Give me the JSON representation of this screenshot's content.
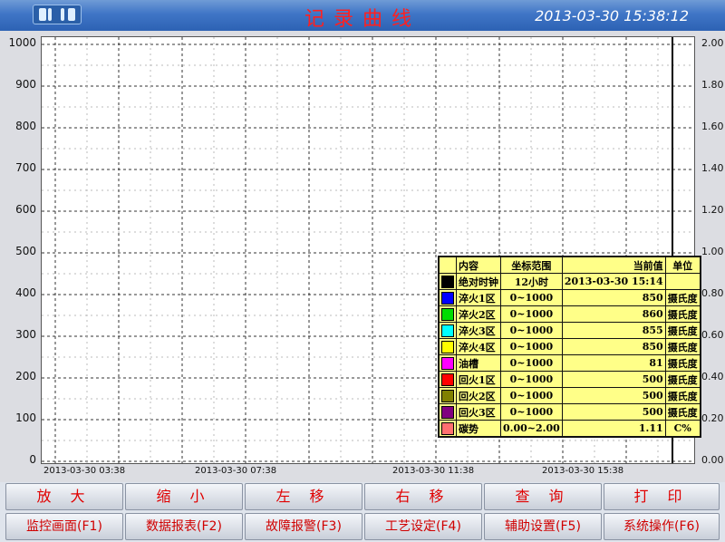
{
  "app": {
    "title": "记录曲线",
    "datetime": "2013-03-30 15:38:12",
    "logo": "HD-logo"
  },
  "chart_data": {
    "type": "line",
    "y_left_ticks": [
      "1000",
      "900",
      "800",
      "700",
      "600",
      "500",
      "400",
      "300",
      "200",
      "100",
      "0"
    ],
    "y_right_ticks": [
      "2.00",
      "1.80",
      "1.60",
      "1.40",
      "1.20",
      "1.00",
      "0.80",
      "0.60",
      "0.40",
      "0.20",
      "0.00"
    ],
    "x_ticks": [
      "2013-03-30 03:38",
      "2013-03-30 07:38",
      "2013-03-30 11:38",
      "2013-03-30 15:38"
    ],
    "ylim_left": [
      0,
      1000
    ],
    "ylim_right": [
      0,
      2
    ],
    "grid": true,
    "series": []
  },
  "legend": {
    "headers": [
      "内容",
      "坐标范围",
      "当前值",
      "单位"
    ],
    "rows": [
      {
        "name": "绝对时钟",
        "range": "12小时",
        "value": "2013-03-30 15:14",
        "unit": "",
        "color": "#000000"
      },
      {
        "name": "淬火1区",
        "range": "0~1000",
        "value": "850",
        "unit": "摄氏度",
        "color": "#0000ff"
      },
      {
        "name": "淬火2区",
        "range": "0~1000",
        "value": "860",
        "unit": "摄氏度",
        "color": "#00dd00"
      },
      {
        "name": "淬火3区",
        "range": "0~1000",
        "value": "855",
        "unit": "摄氏度",
        "color": "#00ffff"
      },
      {
        "name": "淬火4区",
        "range": "0~1000",
        "value": "850",
        "unit": "摄氏度",
        "color": "#ffff00"
      },
      {
        "name": "油槽",
        "range": "0~1000",
        "value": "81",
        "unit": "摄氏度",
        "color": "#ff00ff"
      },
      {
        "name": "回火1区",
        "range": "0~1000",
        "value": "500",
        "unit": "摄氏度",
        "color": "#ff0000"
      },
      {
        "name": "回火2区",
        "range": "0~1000",
        "value": "500",
        "unit": "摄氏度",
        "color": "#808000"
      },
      {
        "name": "回火3区",
        "range": "0~1000",
        "value": "500",
        "unit": "摄氏度",
        "color": "#800080"
      },
      {
        "name": "碳势",
        "range": "0.00~2.00",
        "value": "1.11",
        "unit": "C%",
        "color": "#ff7070"
      }
    ]
  },
  "buttons_row1": [
    "放 大",
    "缩 小",
    "左 移",
    "右 移",
    "查 询",
    "打 印"
  ],
  "buttons_row2": [
    "监控画面(F1)",
    "数据报表(F2)",
    "故障报警(F3)",
    "工艺设定(F4)",
    "辅助设置(F5)",
    "系统操作(F6)"
  ]
}
